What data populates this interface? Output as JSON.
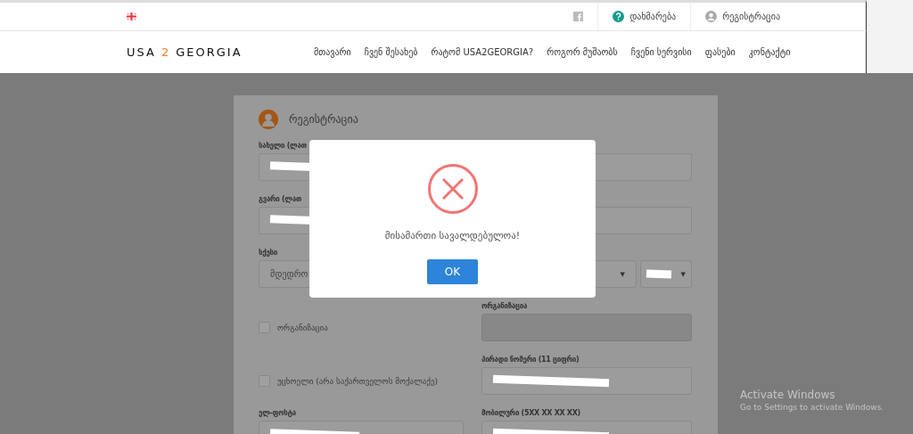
{
  "topbar": {
    "help": "დახმარება",
    "register": "რეგისტრაცია"
  },
  "logo": {
    "left": "USA",
    "middle": "2",
    "right": "GEORGIA"
  },
  "nav": [
    {
      "label": "მთავარი"
    },
    {
      "label": "ჩვენ შესახებ"
    },
    {
      "label": "რატომ USA2GEORGIA?"
    },
    {
      "label": "როგორ მუშაობს"
    },
    {
      "label": "ჩვენი სერვისი"
    },
    {
      "label": "ფასები"
    },
    {
      "label": "კონტაქტი"
    }
  ],
  "form": {
    "title": "რეგისტრაცია",
    "rows": [
      {
        "left": {
          "kind": "input",
          "label": "სახელი (ლათ",
          "redacted": true
        },
        "right": {
          "kind": "input"
        }
      },
      {
        "left": {
          "kind": "input",
          "label": "გვარი (ლათ",
          "redacted": true
        },
        "right": {
          "kind": "input"
        }
      },
      {
        "left": {
          "kind": "select",
          "label": "სქესი",
          "value": "მდედრო"
        },
        "right": {
          "kind": "selects",
          "caret": "▼",
          "caret_small": "▼"
        }
      },
      {
        "left": {
          "kind": "checkbox",
          "label": "ორგანიზაცია",
          "checked": false
        },
        "right": {
          "kind": "input",
          "label": "ორგანიზაცია",
          "disabled": true
        }
      },
      {
        "left": {
          "kind": "checkbox",
          "label": "უცხოელი (არა საქართველოს მოქალაქე)",
          "checked": false
        },
        "right": {
          "kind": "input",
          "label": "პირადი ნომერი (11 ციფრი)",
          "redacted": true
        }
      },
      {
        "left": {
          "kind": "input",
          "label": "ელ-ფოსტა",
          "redacted": true
        },
        "right": {
          "kind": "input",
          "label": "მობილური (5XX XX XX XX)",
          "redacted": true
        }
      }
    ]
  },
  "dialog": {
    "message": "მისამართი სავალდებულოა!",
    "button": "OK"
  },
  "os_notice": {
    "title": "Activate Windows",
    "subtitle": "Go to Settings to activate Windows."
  }
}
